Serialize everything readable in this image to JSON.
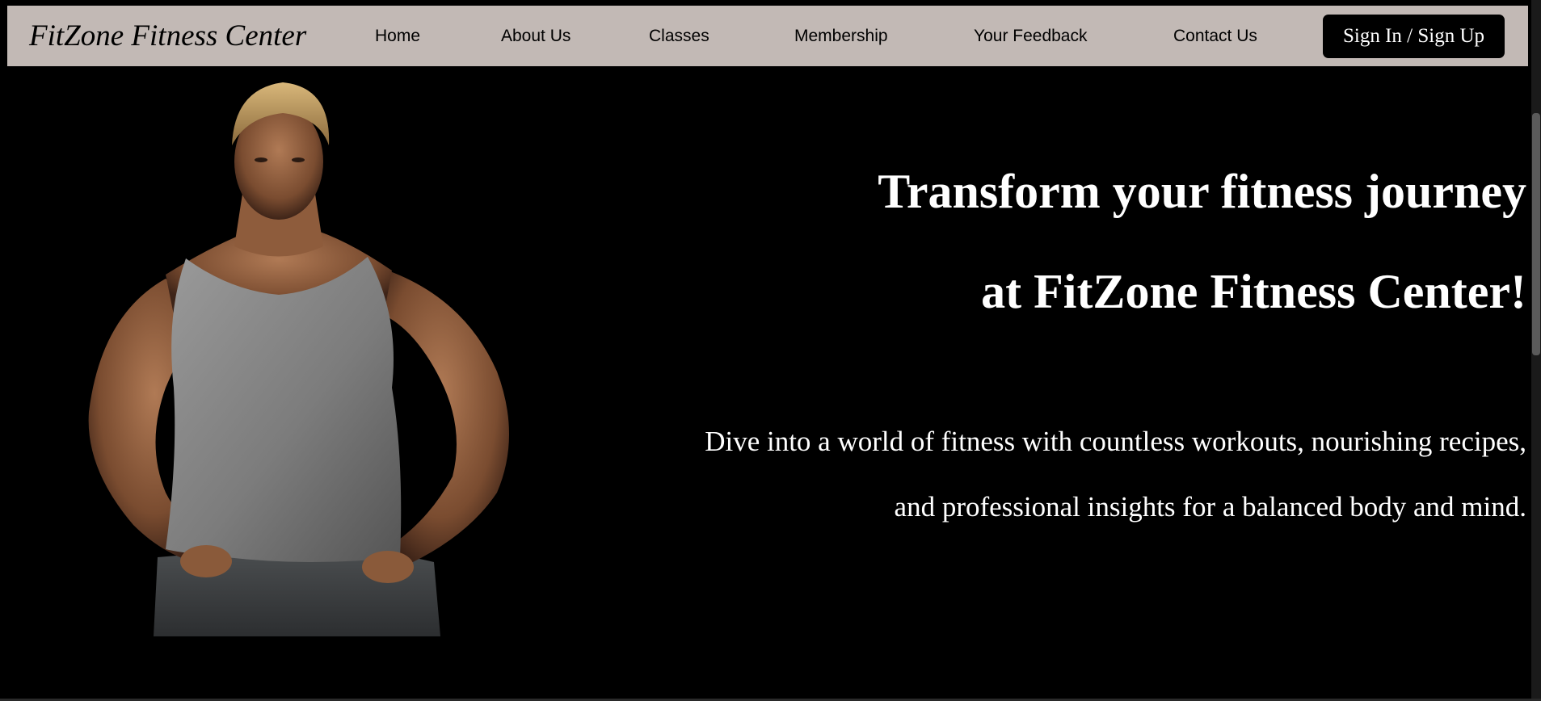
{
  "navbar": {
    "brand": "FitZone Fitness Center",
    "links": [
      "Home",
      "About Us",
      "Classes",
      "Membership",
      "Your Feedback",
      "Contact Us"
    ],
    "signin_label": "Sign In / Sign Up",
    "background_color": "#c2b9b5"
  },
  "hero": {
    "title_line1": "Transform your fitness journey",
    "title_line2": "at FitZone Fitness Center!",
    "sub_line1": "Dive into a world of fitness with countless workouts, nourishing recipes,",
    "sub_line2": "and professional insights for a balanced body and mind."
  }
}
